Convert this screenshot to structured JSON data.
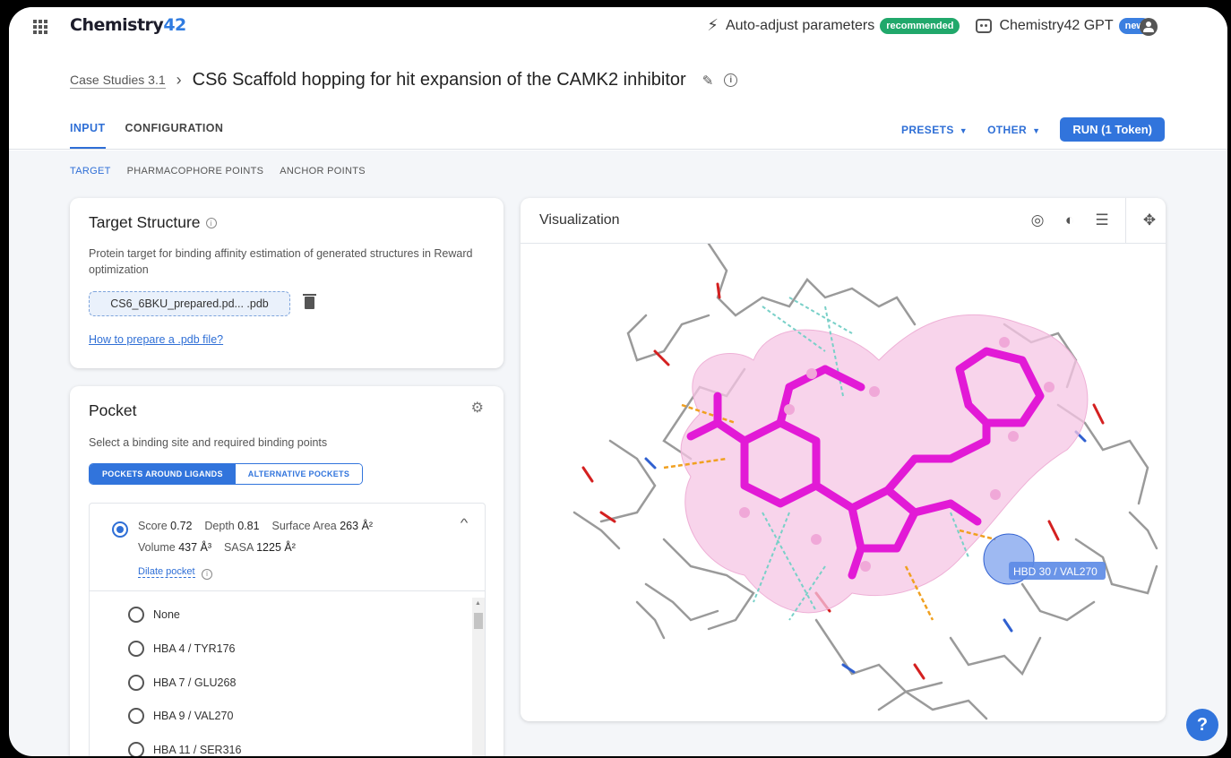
{
  "app": {
    "logo_main": "Chemistry",
    "logo_num": "42"
  },
  "topbar": {
    "auto_adjust": "Auto-adjust parameters",
    "auto_adjust_badge": "recommended",
    "gpt": "Chemistry42 GPT",
    "gpt_badge": "new"
  },
  "breadcrumb": {
    "parent": "Case Studies 3.1",
    "title": "CS6 Scaffold hopping for hit expansion of the CAMK2 inhibitor"
  },
  "tabs": [
    "INPUT",
    "CONFIGURATION"
  ],
  "actions": {
    "presets": "PRESETS",
    "other": "OTHER",
    "run": "RUN  (1 Token)"
  },
  "subtabs": [
    "TARGET",
    "PHARMACOPHORE POINTS",
    "ANCHOR POINTS"
  ],
  "target_card": {
    "title": "Target Structure",
    "description": "Protein target for binding affinity estimation of generated structures in Reward optimization",
    "file": "CS6_6BKU_prepared.pd... .pdb",
    "help_link": "How to prepare a .pdb file?"
  },
  "pocket_card": {
    "title": "Pocket",
    "description": "Select a binding site and required binding points",
    "toggle_on": "POCKETS AROUND LIGANDS",
    "toggle_off": "ALTERNATIVE POCKETS",
    "score_label": "Score",
    "score": "0.72",
    "depth_label": "Depth",
    "depth": "0.81",
    "surface_label": "Surface Area",
    "surface": "263 Å²",
    "volume_label": "Volume",
    "volume": "437 Å³",
    "sasa_label": "SASA",
    "sasa": "1225 Å²",
    "dilate": "Dilate pocket",
    "options": [
      "None",
      "HBA 4 / TYR176",
      "HBA 7 / GLU268",
      "HBA 9 / VAL270",
      "HBA 11 / SER316"
    ]
  },
  "visualization": {
    "title": "Visualization",
    "label": "HBD 30 / VAL270"
  },
  "colors": {
    "accent": "#3174dc",
    "ligand": "#e21ad6",
    "surface": "#f6c6e4",
    "badge_green": "#21a86b"
  },
  "icons": [
    "apps-grid-icon",
    "magic-wand-icon",
    "robot-icon",
    "account-icon",
    "edit-pencil-icon",
    "info-icon",
    "trash-icon",
    "gear-icon",
    "target-icon",
    "palette-icon",
    "tune-icon",
    "move-icon",
    "help-icon"
  ]
}
